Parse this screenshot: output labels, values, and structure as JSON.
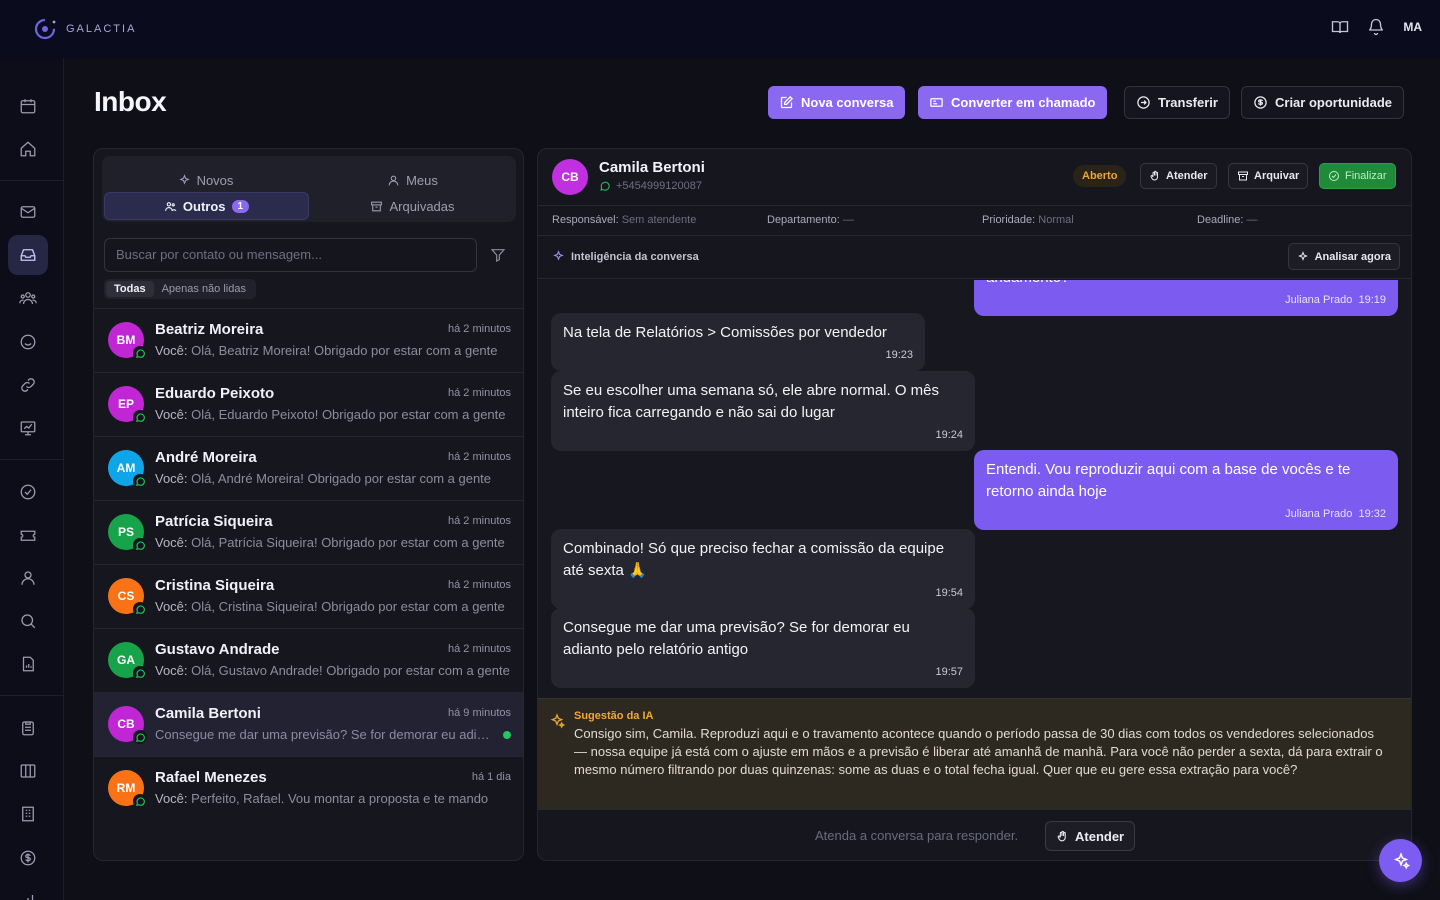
{
  "app": {
    "brand": "GALACTIA",
    "user_initials": "MA"
  },
  "page": {
    "title": "Inbox"
  },
  "header_actions": {
    "new_conversation": "Nova conversa",
    "convert_ticket": "Converter em chamado",
    "transfer": "Transferir",
    "create_opportunity": "Criar oportunidade"
  },
  "tabs": {
    "novos": "Novos",
    "meus": "Meus",
    "outros": "Outros",
    "outros_count": "1",
    "arquivadas": "Arquivadas"
  },
  "search": {
    "placeholder": "Buscar por contato ou mensagem..."
  },
  "filters": {
    "all": "Todas",
    "unread": "Apenas não lidas"
  },
  "conversations": [
    {
      "initials": "BM",
      "name": "Beatriz Moreira",
      "time": "há 2 minutos",
      "prefix": "Você:",
      "preview": " Olá, Beatriz Moreira! Obrigado por estar com a gente",
      "color": "#c026d3"
    },
    {
      "initials": "EP",
      "name": "Eduardo Peixoto",
      "time": "há 2 minutos",
      "prefix": "Você:",
      "preview": " Olá, Eduardo Peixoto! Obrigado por estar com a gente",
      "color": "#c026d3"
    },
    {
      "initials": "AM",
      "name": "André Moreira",
      "time": "há 2 minutos",
      "prefix": "Você:",
      "preview": " Olá, André Moreira! Obrigado por estar com a gente",
      "color": "#0ea5e9"
    },
    {
      "initials": "PS",
      "name": "Patrícia Siqueira",
      "time": "há 2 minutos",
      "prefix": "Você:",
      "preview": " Olá, Patrícia Siqueira! Obrigado por estar com a gente",
      "color": "#16a34a"
    },
    {
      "initials": "CS",
      "name": "Cristina Siqueira",
      "time": "há 2 minutos",
      "prefix": "Você:",
      "preview": " Olá, Cristina Siqueira! Obrigado por estar com a gente",
      "color": "#f97316"
    },
    {
      "initials": "GA",
      "name": "Gustavo Andrade",
      "time": "há 2 minutos",
      "prefix": "Você:",
      "preview": " Olá, Gustavo Andrade! Obrigado por estar com a gente",
      "color": "#16a34a"
    },
    {
      "initials": "CB",
      "name": "Camila Bertoni",
      "time": "há 9 minutos",
      "prefix": "",
      "preview": "Consegue me dar uma previsão? Se for demorar eu adianto pelo relatório antigo",
      "color": "#c026d3"
    },
    {
      "initials": "RM",
      "name": "Rafael Menezes",
      "time": "há 1 dia",
      "prefix": "Você:",
      "preview": " Perfeito, Rafael. Vou montar a proposta e te mando",
      "color": "#f97316"
    }
  ],
  "chat": {
    "initials": "CB",
    "name": "Camila Bertoni",
    "phone": "+5454999120087",
    "status": "Aberto",
    "attend": "Atender",
    "archive": "Arquivar",
    "finish": "Finalizar",
    "meta": {
      "responsible_label": "Responsável:",
      "responsible": "Sem atendente",
      "department_label": "Departamento:",
      "department": "—",
      "priority_label": "Prioridade:",
      "priority": "Normal",
      "deadline_label": "Deadline:",
      "deadline": "—"
    },
    "intelligence_label": "Inteligência da conversa",
    "analyze": "Analisar agora",
    "messages": [
      {
        "dir": "out",
        "text": "andamento?",
        "author": "Juliana Prado",
        "time": "19:19"
      },
      {
        "dir": "in",
        "text": "Na tela de Relatórios > Comissões por vendedor",
        "time": "19:23"
      },
      {
        "dir": "in",
        "text": "Se eu escolher uma semana só, ele abre normal. O mês inteiro fica carregando e não sai do lugar",
        "time": "19:24"
      },
      {
        "dir": "out",
        "text": "Entendi. Vou reproduzir aqui com a base de vocês e te retorno ainda hoje",
        "author": "Juliana Prado",
        "time": "19:32"
      },
      {
        "dir": "in",
        "text": "Combinado! Só que preciso fechar a comissão da equipe até sexta 🙏",
        "time": "19:54"
      },
      {
        "dir": "in",
        "text": "Consegue me dar uma previsão? Se for demorar eu adianto pelo relatório antigo",
        "time": "19:57"
      }
    ],
    "suggestion_title": "Sugestão da IA",
    "suggestion": "Consigo sim, Camila. Reproduzi aqui e o travamento acontece quando o período passa de 30 dias com todos os vendedores selecionados — nossa equipe já está com o ajuste em mãos e a previsão é liberar até amanhã de manhã. Para você não perder a sexta, dá para extrair o mesmo número filtrando por duas quinzenas: some as duas e o total fecha igual. Quer que eu gere essa extração para você?",
    "reply_hint": "Atenda a conversa para responder.",
    "reply_button": "Atender"
  },
  "colors": {
    "accent": "#8b68f0",
    "status_open": "#f0a33c",
    "success": "#22c55e",
    "whatsapp": "#22c55e"
  }
}
